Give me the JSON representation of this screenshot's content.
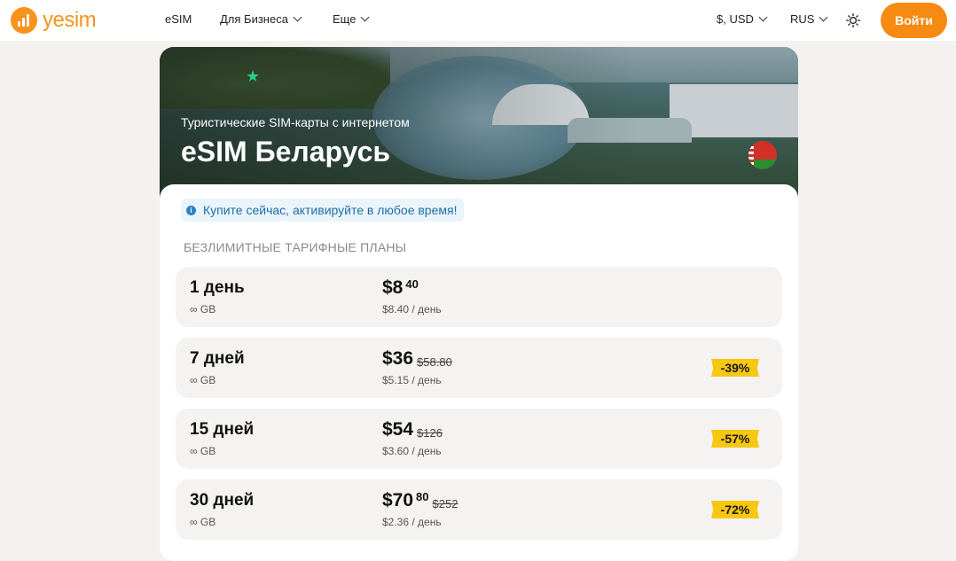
{
  "header": {
    "logo_text": "yesim",
    "nav": {
      "esim": "eSIM",
      "business": "Для Бизнеса",
      "more": "Еще"
    },
    "currency": "$, USD",
    "language": "RUS",
    "login_label": "Войти"
  },
  "hero": {
    "subtitle": "Туристические SIM-карты с интернетом",
    "title": "eSIM Беларусь"
  },
  "notice": {
    "icon": "info-icon",
    "text": "Купите сейчас, активируйте в любое время!"
  },
  "section_title": "БЕЗЛИМИТНЫЕ ТАРИФНЫЕ ПЛАНЫ",
  "plans": [
    {
      "days": "1 день",
      "gb": "∞ GB",
      "price": "$8",
      "cents": "40",
      "old_price": "",
      "per_day": "$8.40 / день",
      "discount": ""
    },
    {
      "days": "7 дней",
      "gb": "∞ GB",
      "price": "$36",
      "cents": "",
      "old_price": "$58.80",
      "per_day": "$5.15 / день",
      "discount": "-39%"
    },
    {
      "days": "15 дней",
      "gb": "∞ GB",
      "price": "$54",
      "cents": "",
      "old_price": "$126",
      "per_day": "$3.60 / день",
      "discount": "-57%"
    },
    {
      "days": "30 дней",
      "gb": "∞ GB",
      "price": "$70",
      "cents": "80",
      "old_price": "$252",
      "per_day": "$2.36 / день",
      "discount": "-72%"
    }
  ],
  "colors": {
    "brand": "#f78a12",
    "badge": "#f7c711",
    "notice_text": "#1f6fa6"
  }
}
